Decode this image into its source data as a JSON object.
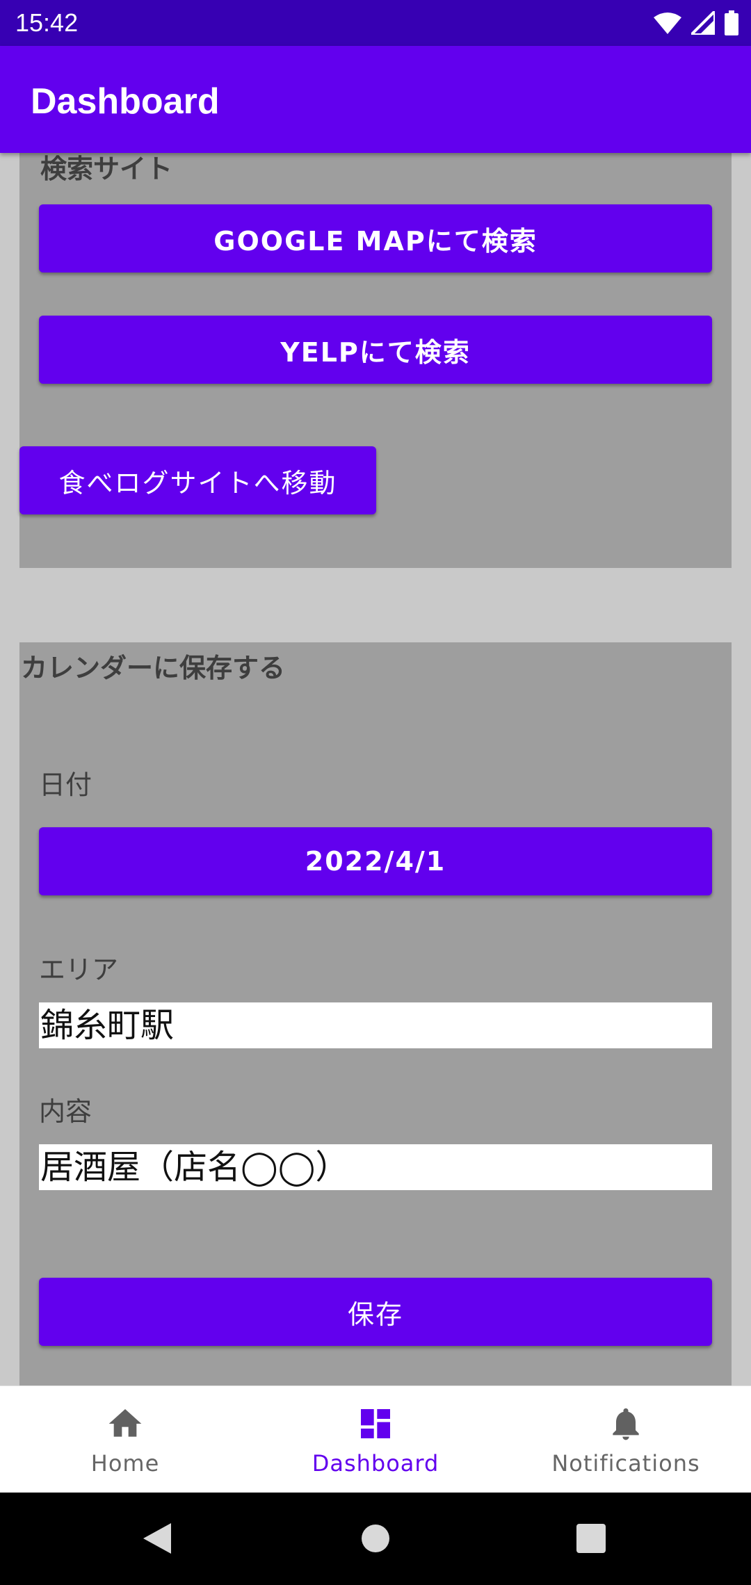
{
  "status_bar": {
    "time": "15:42"
  },
  "app_bar": {
    "title": "Dashboard"
  },
  "search_section": {
    "heading": "検索サイト",
    "google_button": "GOOGLE MAPにて検索",
    "yelp_button": "YELPにて検索"
  },
  "tabelog_button": "食べログサイトへ移動",
  "calendar_section": {
    "heading": "カレンダーに保存する",
    "date_label": "日付",
    "date_button": "2022/4/1",
    "area_label": "エリア",
    "area_value": "錦糸町駅",
    "content_label": "内容",
    "content_value": "居酒屋（店名◯◯）",
    "save_button": "保存"
  },
  "bottom_nav": {
    "items": [
      {
        "label": "Home",
        "icon": "home-icon",
        "active": false
      },
      {
        "label": "Dashboard",
        "icon": "dashboard-icon",
        "active": true
      },
      {
        "label": "Notifications",
        "icon": "bell-icon",
        "active": false
      }
    ]
  },
  "colors": {
    "primary": "#6200ee",
    "primary_dark": "#3700b3",
    "panel": "#9e9e9e",
    "background": "#c9c9c9"
  }
}
